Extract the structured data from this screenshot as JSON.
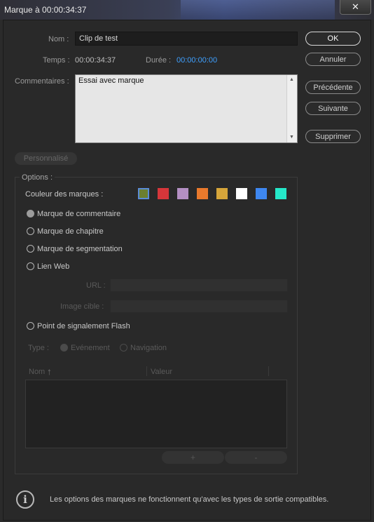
{
  "window": {
    "title": "Marque à 00:00:34:37",
    "close_icon": "close-icon",
    "close_glyph": "✕"
  },
  "form": {
    "name_label": "Nom :",
    "name_value": "Clip de test",
    "time_label": "Temps :",
    "time_value": "00:00:34:37",
    "duration_label": "Durée :",
    "duration_value": "00:00:00:00",
    "duration_color": "#3fa0ff",
    "comments_label": "Commentaires :",
    "comments_value": "Essai avec marque"
  },
  "buttons": {
    "ok": "OK",
    "cancel": "Annuler",
    "previous": "Précédente",
    "next": "Suivante",
    "delete": "Supprimer",
    "custom": "Personnalisé"
  },
  "options": {
    "title": "Options :",
    "colors_label": "Couleur des marques :",
    "colors": [
      "#6b7f30",
      "#d6363a",
      "#b48fc3",
      "#e9792c",
      "#d6a53a",
      "#ffffff",
      "#3e87f0",
      "#25e8c9"
    ],
    "selected_color_index": 0,
    "marker_types": [
      {
        "label": "Marque de commentaire",
        "selected": true
      },
      {
        "label": "Marque de chapitre",
        "selected": false
      },
      {
        "label": "Marque de segmentation",
        "selected": false
      },
      {
        "label": "Lien Web",
        "selected": false
      }
    ],
    "url_label": "URL :",
    "target_label": "Image cible :",
    "flash_label": "Point de signalement Flash",
    "type_label": "Type :",
    "type_event": "Evénement",
    "type_navigation": "Navigation",
    "col_name": "Nom",
    "col_name_sort_icon": "sort-up-icon",
    "col_value": "Valeur",
    "add": "+",
    "remove": "-"
  },
  "footer": {
    "info_icon": "info-icon",
    "text": "Les options des marques ne fonctionnent qu'avec les types de sortie compatibles."
  }
}
